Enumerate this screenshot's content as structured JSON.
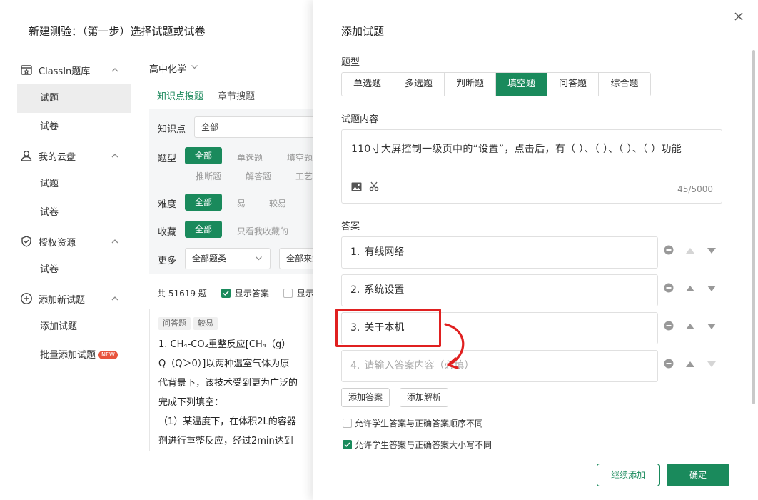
{
  "page": {
    "title": "新建测验：（第一步）选择试题或试卷"
  },
  "sidebar": {
    "groups": [
      {
        "label": "ClassIn题库",
        "items": [
          "试题",
          "试卷"
        ]
      },
      {
        "label": "我的云盘",
        "items": [
          "试题",
          "试卷"
        ]
      },
      {
        "label": "授权资源",
        "items": [
          "试卷"
        ]
      },
      {
        "label": "添加新试题",
        "items": [
          "添加试题",
          "批量添加试题"
        ],
        "badge": "NEW"
      }
    ]
  },
  "subject": {
    "value": "高中化学"
  },
  "search_tabs": [
    "知识点搜题",
    "章节搜题"
  ],
  "filters": {
    "knowledge": {
      "label": "知识点",
      "value": "全部"
    },
    "type": {
      "label": "题型",
      "all": "全部",
      "options": [
        "单选题",
        "填空题",
        "推断题",
        "解答题",
        "工艺"
      ]
    },
    "difficulty": {
      "label": "难度",
      "all": "全部",
      "options": [
        "易",
        "较易"
      ]
    },
    "favorite": {
      "label": "收藏",
      "all": "全部",
      "options": [
        "只看我收藏的"
      ]
    },
    "more": {
      "label": "更多",
      "select1": "全部题类",
      "select2": "全部来源"
    }
  },
  "results": {
    "count": "共 51619 题",
    "show_answer": "显示答案",
    "show_other": "显示"
  },
  "question_card": {
    "tags": [
      "问答题",
      "较易"
    ],
    "lines": [
      "1. CH₄-CO₂重整反应[CH₄（g）",
      "Q（Q＞0）]以两种温室气体为原",
      "代背景下，该技术受到更为广泛的",
      "完成下列填空：",
      "（1）某温度下，在体积2L的容器",
      "剂进行重整反应，经过2min达到"
    ]
  },
  "drawer": {
    "title": "添加试题",
    "type_label": "题型",
    "types": [
      "单选题",
      "多选题",
      "判断题",
      "填空题",
      "问答题",
      "综合题"
    ],
    "active_type": "填空题",
    "content_label": "试题内容",
    "content_text": "110寸大屏控制一级页中的“设置”，点击后，有（ ）、（ ）、（ ）、（ ）功能",
    "content_count": "45/5000",
    "answer_label": "答案",
    "answers": [
      {
        "num": "1.",
        "text": "有线网络"
      },
      {
        "num": "2.",
        "text": "系统设置"
      },
      {
        "num": "3.",
        "text": "关于本机"
      },
      {
        "num": "4.",
        "placeholder": "请输入答案内容（必填）"
      }
    ],
    "add_answer": "添加答案",
    "add_analysis": "添加解析",
    "option_order": "允许学生答案与正确答案顺序不同",
    "option_case": "允许学生答案与正确答案大小写不同",
    "continue_btn": "继续添加",
    "confirm_btn": "确定"
  },
  "colors": {
    "accent": "#1a8a5c",
    "annotation": "#e02020"
  }
}
